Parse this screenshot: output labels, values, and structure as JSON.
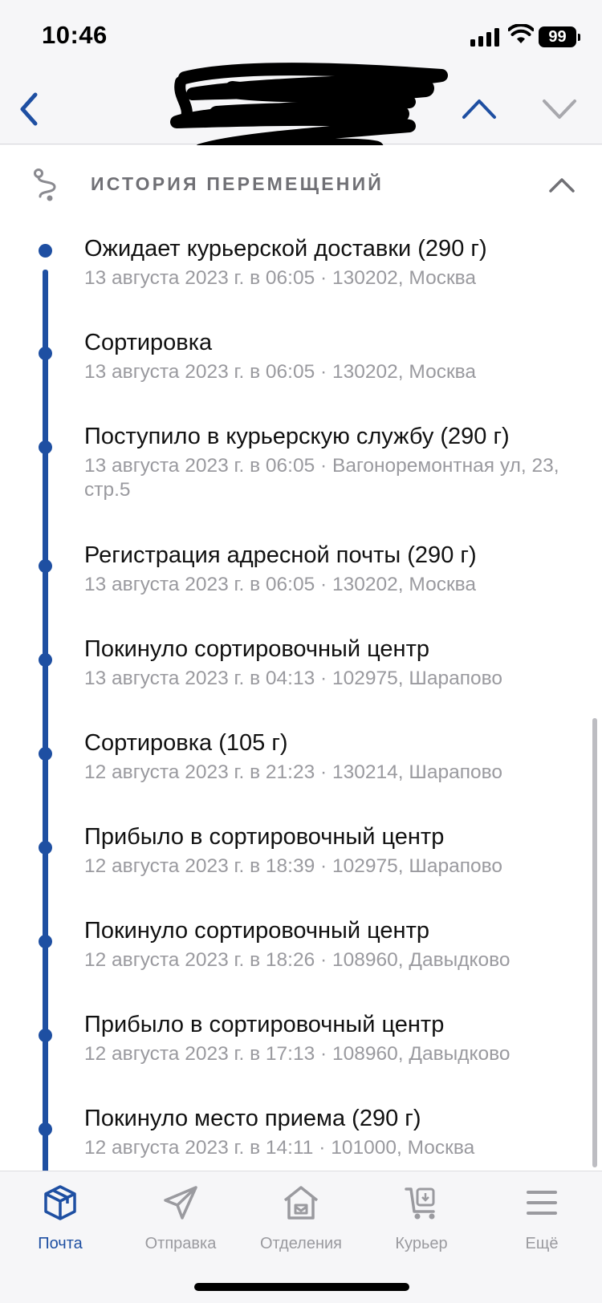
{
  "status_bar": {
    "time": "10:46",
    "battery": "99",
    "icons": [
      "signal-icon",
      "wifi-icon",
      "battery-icon"
    ]
  },
  "nav": {
    "back_icon": "chevron-left-icon",
    "title_redacted": true,
    "up_icon": "chevron-up-icon",
    "down_icon": "chevron-down-icon"
  },
  "section": {
    "icon": "route-icon",
    "title": "ИСТОРИЯ ПЕРЕМЕЩЕНИЙ",
    "toggle_icon": "chevron-up-icon"
  },
  "events": [
    {
      "title": "Ожидает курьерской доставки  (290 г)",
      "detail": "13 августа 2023 г. в 06:05 · 130202, Москва"
    },
    {
      "title": "Сортировка",
      "detail": "13 августа 2023 г. в 06:05 · 130202, Москва"
    },
    {
      "title": "Поступило в курьерскую службу  (290 г)",
      "detail": "13 августа 2023 г. в 06:05 · Вагоноремонтная ул, 23, стр.5"
    },
    {
      "title": "Регистрация адресной почты  (290 г)",
      "detail": "13 августа 2023 г. в 06:05 · 130202, Москва"
    },
    {
      "title": "Покинуло сортировочный центр",
      "detail": "13 августа 2023 г. в 04:13 · 102975, Шарапово"
    },
    {
      "title": "Сортировка  (105 г)",
      "detail": "12 августа 2023 г. в 21:23 · 130214, Шарапово"
    },
    {
      "title": "Прибыло в сортировочный центр",
      "detail": "12 августа 2023 г. в 18:39 · 102975, Шарапово"
    },
    {
      "title": "Покинуло сортировочный центр",
      "detail": "12 августа 2023 г. в 18:26 · 108960, Давыдково"
    },
    {
      "title": "Прибыло в сортировочный центр",
      "detail": "12 августа 2023 г. в 17:13 · 108960, Давыдково"
    },
    {
      "title": "Покинуло место приема  (290 г)",
      "detail": "12 августа 2023 г. в 14:11 · 101000, Москва"
    }
  ],
  "tabs": [
    {
      "label": "Почта",
      "icon": "box-icon",
      "active": true
    },
    {
      "label": "Отправка",
      "icon": "paper-plane-icon",
      "active": false
    },
    {
      "label": "Отделения",
      "icon": "post-office-icon",
      "active": false
    },
    {
      "label": "Курьер",
      "icon": "courier-cart-icon",
      "active": false
    },
    {
      "label": "Ещё",
      "icon": "menu-icon",
      "active": false
    }
  ],
  "colors": {
    "accent": "#1e4fa2",
    "secondary_text": "#9a9a9f",
    "background": "#f6f6f8"
  }
}
